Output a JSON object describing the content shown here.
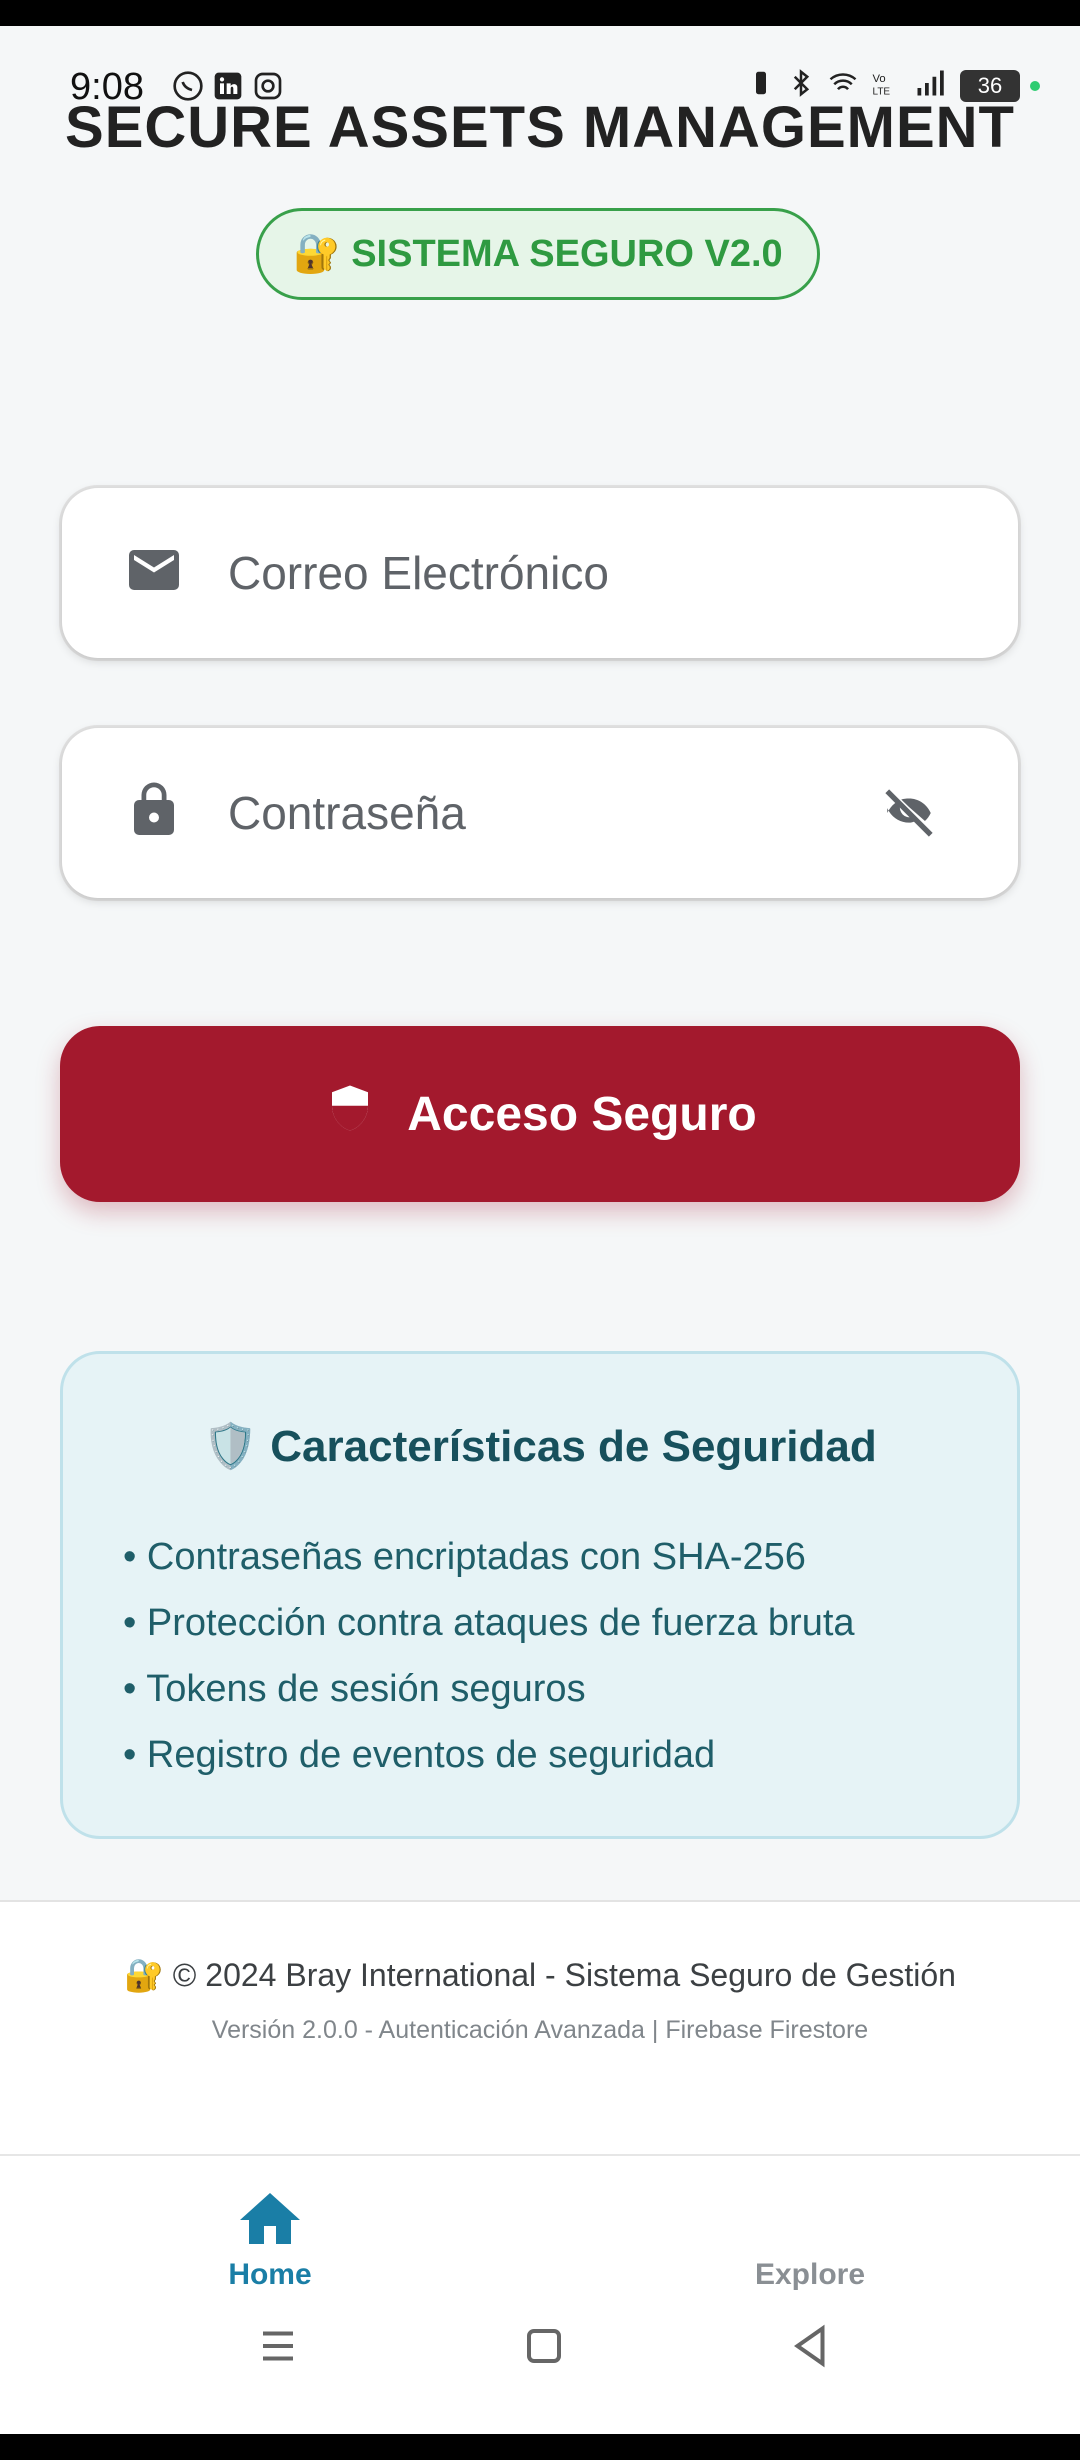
{
  "status_bar": {
    "time": "9:08",
    "battery": "36"
  },
  "app": {
    "title": "SECURE ASSETS MANAGEMENT",
    "badge": "🔐 SISTEMA SEGURO V2.0"
  },
  "form": {
    "email_placeholder": "Correo Electrónico",
    "password_placeholder": "Contraseña",
    "submit_label": "Acceso Seguro"
  },
  "features": {
    "title": "🛡️ Características de Seguridad",
    "items": [
      "Contraseñas encriptadas con SHA-256",
      "Protección contra ataques de fuerza bruta",
      "Tokens de sesión seguros",
      "Registro de eventos de seguridad"
    ]
  },
  "footer": {
    "line1": "🔐 © 2024 Bray International - Sistema Seguro de Gestión",
    "line2": "Versión 2.0.0 - Autenticación Avanzada | Firebase Firestore"
  },
  "bottom_nav": {
    "items": [
      {
        "label": "Home",
        "icon": "home-icon",
        "active": true
      },
      {
        "label": "Explore",
        "icon": "explore-icon",
        "active": false
      }
    ]
  },
  "colors": {
    "primary": "#a3192d",
    "badge_green": "#2f9a41",
    "accent_blue": "#1a7ea6",
    "feature_text": "#17505c"
  }
}
